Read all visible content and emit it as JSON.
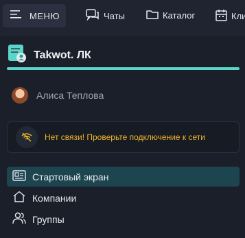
{
  "topbar": {
    "menu_label": "МЕНЮ",
    "items": [
      {
        "label": "Чаты",
        "icon": "chat-icon"
      },
      {
        "label": "Каталог",
        "icon": "folder-icon"
      },
      {
        "label": "Кли",
        "icon": "calendar-icon"
      }
    ]
  },
  "brand": {
    "title": "Takwot. ЛК",
    "logo_icon": "document-user-icon",
    "accent_color": "#5cd6c8"
  },
  "user": {
    "name": "Алиса Теплова"
  },
  "alert": {
    "text": "Нет связи! Проверьте подключение к сети",
    "icon": "no-wifi-icon",
    "color": "#f0b429"
  },
  "nav": {
    "items": [
      {
        "label": "Стартовый экран",
        "icon": "home-screen-icon",
        "active": true
      },
      {
        "label": "Компании",
        "icon": "house-icon",
        "active": false
      },
      {
        "label": "Группы",
        "icon": "group-icon",
        "active": false
      }
    ]
  }
}
